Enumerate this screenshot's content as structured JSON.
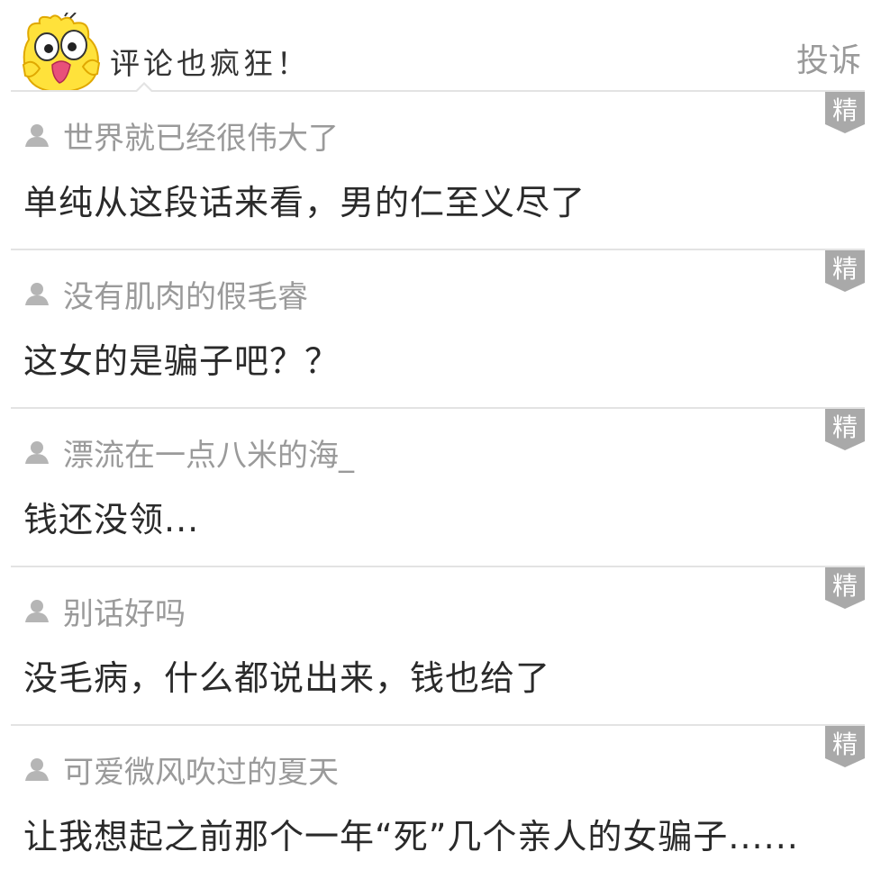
{
  "header": {
    "title": "评论也疯狂！",
    "report_label": "投诉",
    "mascot_icon": "yellow-chick-mascot"
  },
  "badge_label": "精",
  "colors": {
    "username": "#9a9a9a",
    "text": "#2a2a2a",
    "divider": "#e3e3e3",
    "badge": "#a9a9a9"
  },
  "comments": [
    {
      "username": "世界就已经很伟大了",
      "text": "单纯从这段话来看，男的仁至义尽了"
    },
    {
      "username": "没有肌肉的假毛睿",
      "text": "这女的是骗子吧？？"
    },
    {
      "username": "漂流在一点八米的海_",
      "text": "钱还没领..."
    },
    {
      "username": "别话好吗",
      "text": "没毛病，什么都说出来，钱也给了"
    },
    {
      "username": "可爱微风吹过的夏天",
      "text": "让我想起之前那个一年“死”几个亲人的女骗子......"
    }
  ]
}
